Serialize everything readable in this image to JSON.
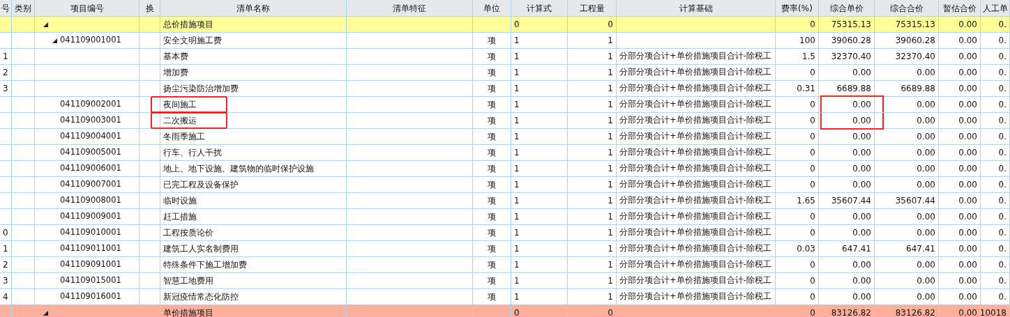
{
  "columns": [
    "号",
    "类别",
    "项目编号",
    "换",
    "清单名称",
    "清单特征",
    "单位",
    "计算式",
    "工程量",
    "计算基础",
    "费率(%)",
    "综合单价",
    "综合合价",
    "暂估合价",
    "人工单"
  ],
  "rows": [
    {
      "kind": "section",
      "color": "#ffff99",
      "expanded": true,
      "name": "总价措施项目",
      "formula": "0",
      "quantity": "0",
      "rate": "0",
      "unit_price": "75315.13",
      "total": "75315.13",
      "provisional": "0.00",
      "labor": "0.",
      "children": [
        {
          "kind": "item",
          "expanded": true,
          "code": "041109001001",
          "name": "安全文明施工费",
          "unit": "项",
          "formula": "1",
          "quantity": "1",
          "rate": "100",
          "unit_price": "39060.28",
          "total": "39060.28",
          "provisional": "0.00",
          "labor": "0.",
          "children": [
            {
              "kind": "item",
              "seq": "1",
              "name": "基本费",
              "unit": "项",
              "formula": "1",
              "quantity": "1",
              "basis": "分部分项合计+单价措施项目合计-除税工",
              "rate": "1.5",
              "unit_price": "32370.40",
              "total": "32370.40",
              "provisional": "0.00",
              "labor": "0."
            },
            {
              "kind": "item",
              "seq": "2",
              "name": "增加费",
              "unit": "项",
              "formula": "1",
              "quantity": "1",
              "basis": "分部分项合计+单价措施项目合计-除税工",
              "rate": "0",
              "unit_price": "0.00",
              "total": "0.00",
              "provisional": "0.00",
              "labor": "0."
            },
            {
              "kind": "item",
              "seq": "3",
              "name": "扬尘污染防治增加费",
              "unit": "项",
              "formula": "1",
              "quantity": "1",
              "basis": "分部分项合计+单价措施项目合计-除税工",
              "rate": "0.31",
              "unit_price": "6689.88",
              "total": "6689.88",
              "provisional": "0.00",
              "labor": "0."
            }
          ]
        },
        {
          "kind": "item",
          "code": "041109002001",
          "name": "夜间施工",
          "marks": {
            "name": true,
            "unit_price": true
          },
          "unit": "项",
          "formula": "1",
          "quantity": "1",
          "basis": "分部分项合计+单价措施项目合计-除税工",
          "rate": "0",
          "unit_price": "0.00",
          "total": "0.00",
          "provisional": "0.00",
          "labor": "0."
        },
        {
          "kind": "item",
          "code": "041109003001",
          "name": "二次搬运",
          "marks": {
            "name": true,
            "unit_price": true
          },
          "unit": "项",
          "formula": "1",
          "quantity": "1",
          "basis": "分部分项合计+单价措施项目合计-除税工",
          "rate": "0",
          "unit_price": "0.00",
          "total": "0.00",
          "provisional": "0.00",
          "labor": "0."
        },
        {
          "kind": "item",
          "code": "041109004001",
          "name": "冬雨季施工",
          "unit": "项",
          "formula": "1",
          "quantity": "1",
          "basis": "分部分项合计+单价措施项目合计-除税工",
          "rate": "0",
          "unit_price": "0.00",
          "total": "0.00",
          "provisional": "0.00",
          "labor": "0."
        },
        {
          "kind": "item",
          "code": "041109005001",
          "name": "行车、行人干扰",
          "unit": "项",
          "formula": "1",
          "quantity": "1",
          "basis": "分部分项合计+单价措施项目合计-除税工",
          "rate": "0",
          "unit_price": "0.00",
          "total": "0.00",
          "provisional": "0.00",
          "labor": "0."
        },
        {
          "kind": "item",
          "code": "041109006001",
          "name": "地上、地下设施、建筑物的临时保护设施",
          "unit": "项",
          "formula": "1",
          "quantity": "1",
          "basis": "分部分项合计+单价措施项目合计-除税工",
          "rate": "0",
          "unit_price": "0.00",
          "total": "0.00",
          "provisional": "0.00",
          "labor": "0."
        },
        {
          "kind": "item",
          "code": "041109007001",
          "name": "已完工程及设备保护",
          "unit": "项",
          "formula": "1",
          "quantity": "1",
          "basis": "分部分项合计+单价措施项目合计-除税工",
          "rate": "0",
          "unit_price": "0.00",
          "total": "0.00",
          "provisional": "0.00",
          "labor": "0."
        },
        {
          "kind": "item",
          "code": "041109008001",
          "name": "临时设施",
          "unit": "项",
          "formula": "1",
          "quantity": "1",
          "basis": "分部分项合计+单价措施项目合计-除税工",
          "rate": "1.65",
          "unit_price": "35607.44",
          "total": "35607.44",
          "provisional": "0.00",
          "labor": "0."
        },
        {
          "kind": "item",
          "code": "041109009001",
          "name": "赶工措施",
          "unit": "项",
          "formula": "1",
          "quantity": "1",
          "basis": "分部分项合计+单价措施项目合计-除税工",
          "rate": "0",
          "unit_price": "0.00",
          "total": "0.00",
          "provisional": "0.00",
          "labor": "0."
        },
        {
          "kind": "item",
          "seq": "0",
          "code": "041109010001",
          "name": "工程按质论价",
          "unit": "项",
          "formula": "1",
          "quantity": "1",
          "basis": "分部分项合计+单价措施项目合计-除税工",
          "rate": "0",
          "unit_price": "0.00",
          "total": "0.00",
          "provisional": "0.00",
          "labor": "0."
        },
        {
          "kind": "item",
          "seq": "1",
          "code": "041109011001",
          "name": "建筑工人实名制费用",
          "unit": "项",
          "formula": "1",
          "quantity": "1",
          "basis": "分部分项合计+单价措施项目合计-除税工",
          "rate": "0.03",
          "unit_price": "647.41",
          "total": "647.41",
          "provisional": "0.00",
          "labor": "0."
        },
        {
          "kind": "item",
          "seq": "2",
          "code": "041109091001",
          "name": "特殊条件下施工增加费",
          "unit": "项",
          "formula": "1",
          "quantity": "1",
          "basis": "分部分项合计+单价措施项目合计-除税工",
          "rate": "0",
          "unit_price": "0.00",
          "total": "0.00",
          "provisional": "0.00",
          "labor": "0."
        },
        {
          "kind": "item",
          "seq": "3",
          "code": "041109015001",
          "name": "智慧工地费用",
          "unit": "项",
          "formula": "1",
          "quantity": "1",
          "basis": "分部分项合计+单价措施项目合计-除税工",
          "rate": "0",
          "unit_price": "0.00",
          "total": "0.00",
          "provisional": "0.00",
          "labor": "0."
        },
        {
          "kind": "item",
          "seq": "4",
          "code": "041109016001",
          "name": "新冠疫情常态化防控",
          "unit": "项",
          "formula": "1",
          "quantity": "1",
          "basis": "分部分项合计+单价措施项目合计-除税工",
          "rate": "0",
          "unit_price": "0.00",
          "total": "0.00",
          "provisional": "0.00",
          "labor": "0."
        }
      ]
    },
    {
      "kind": "section",
      "color": "#ffb09c",
      "expanded": true,
      "name": "单价措施项目",
      "formula": "0",
      "quantity": "0",
      "rate": "0",
      "unit_price": "83126.82",
      "total": "83126.82",
      "provisional": "0.00",
      "labor": "10018"
    }
  ]
}
